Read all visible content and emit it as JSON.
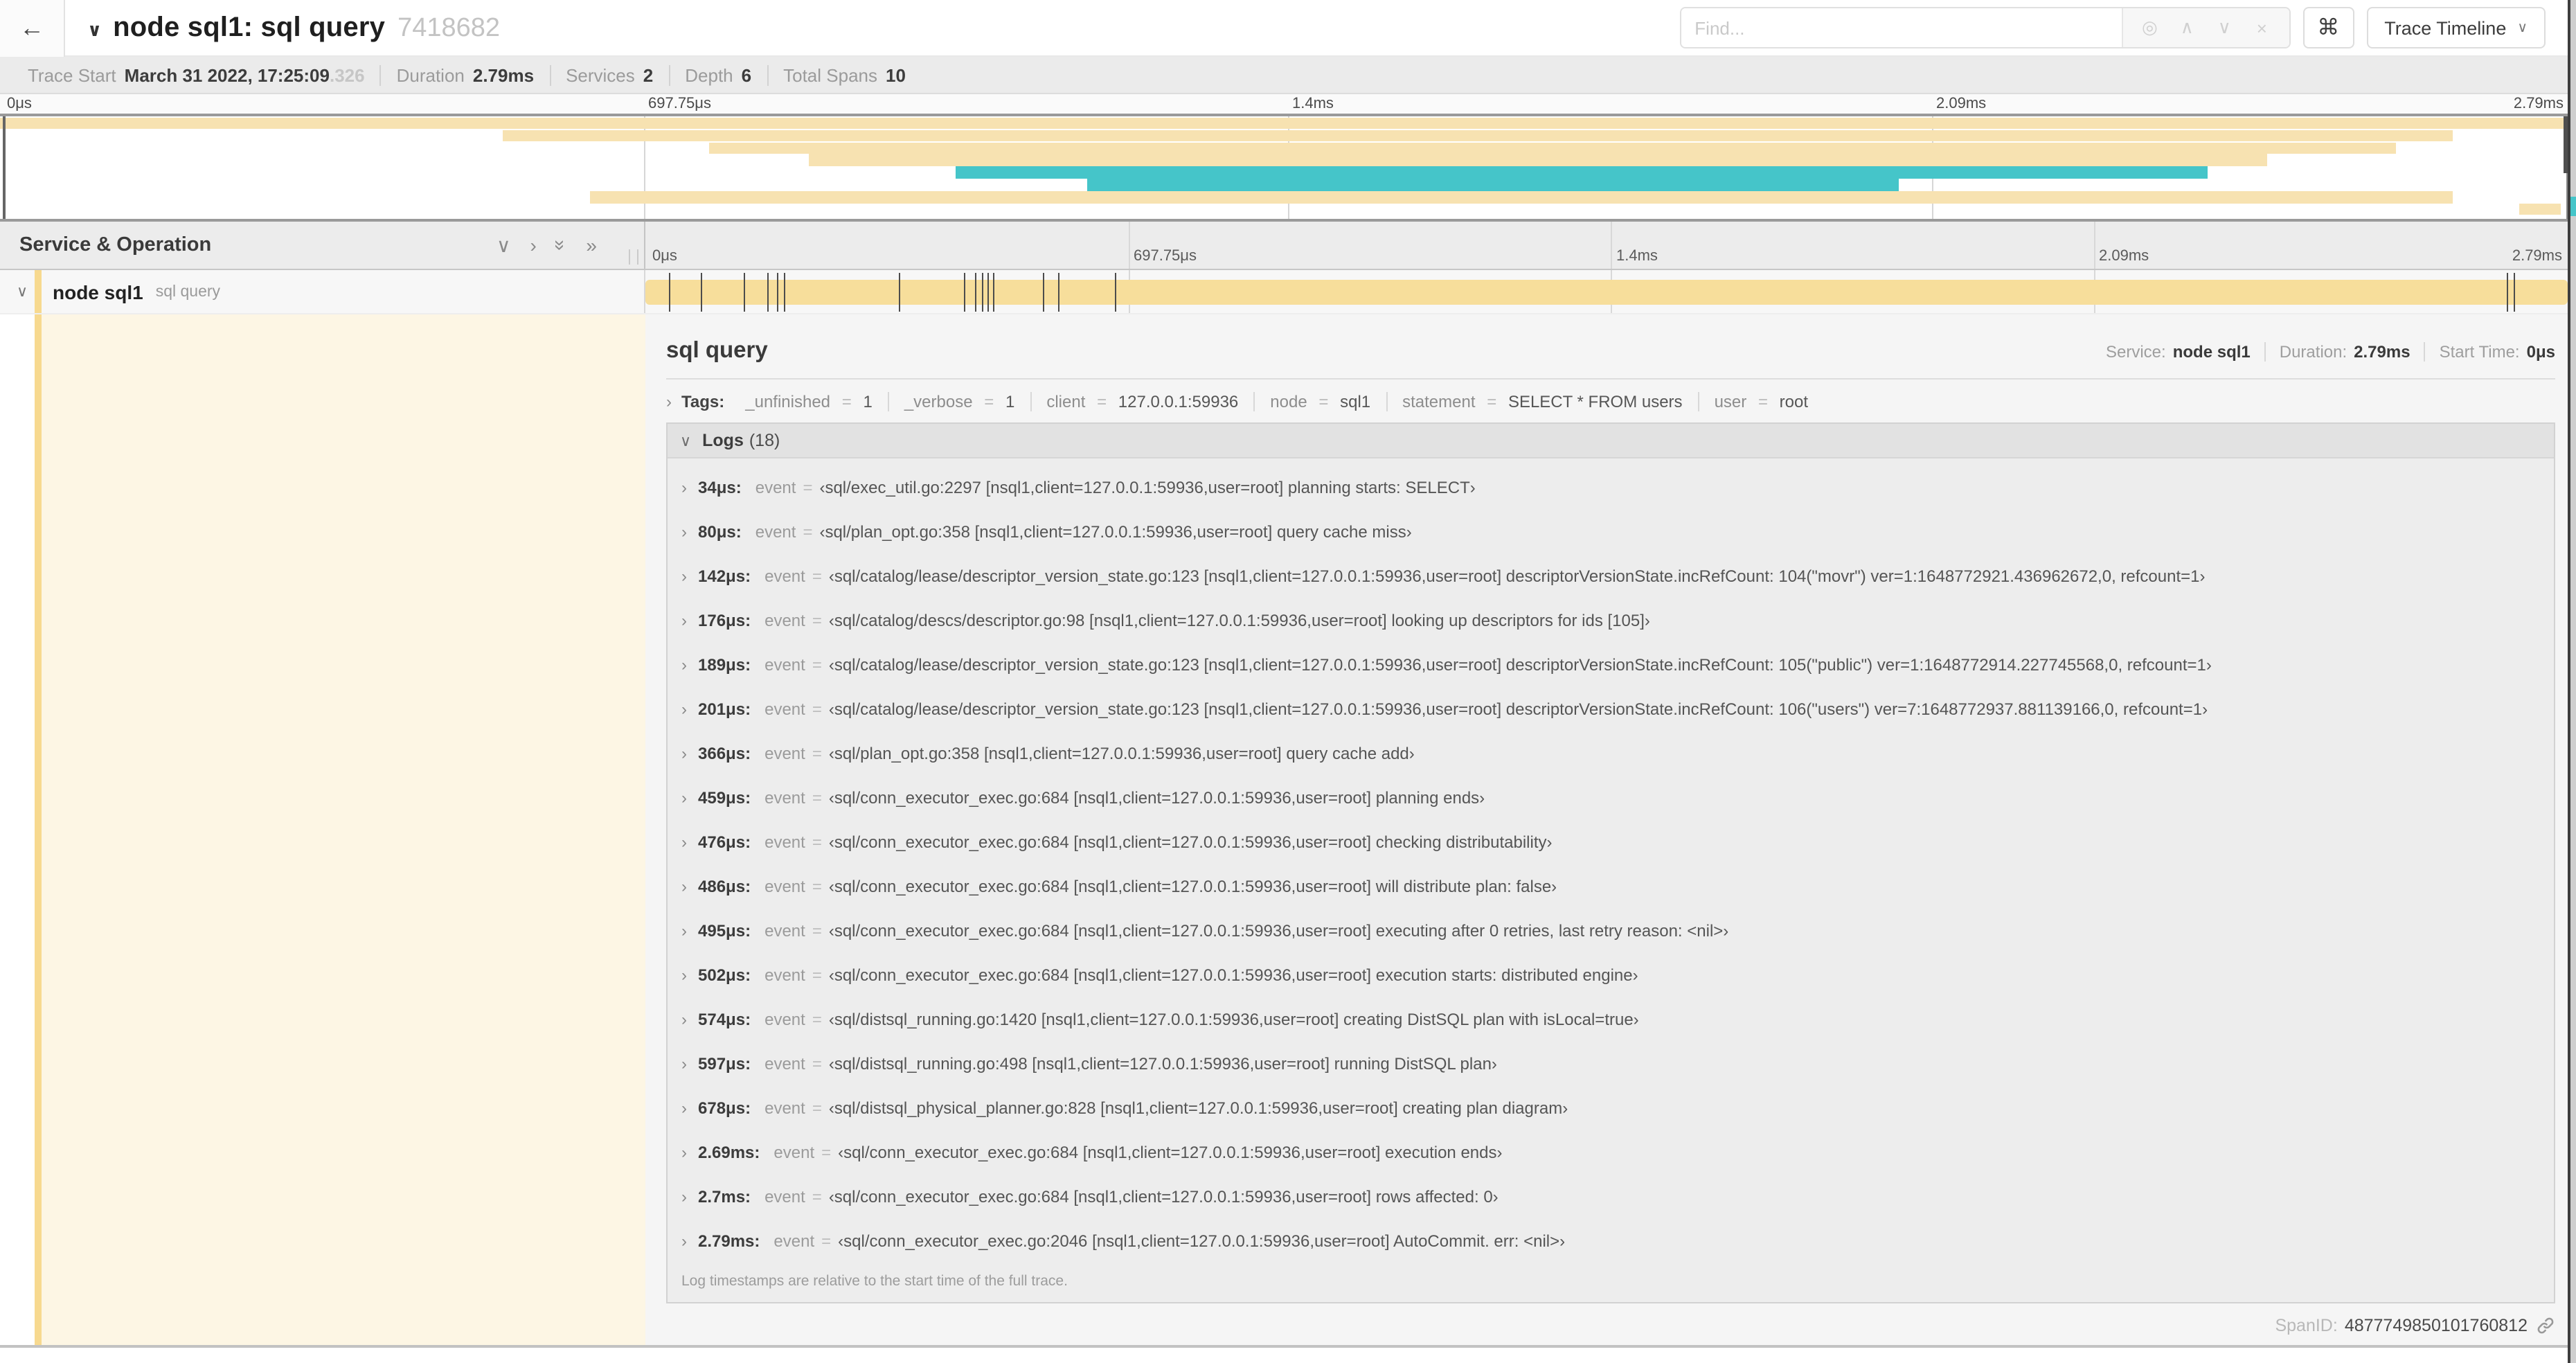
{
  "icons": {
    "back_arrow": "←",
    "chevron_down": "∨",
    "chevron_up": "∧",
    "chevron_right": "›",
    "double_chevron_right": "»",
    "locate": "◎",
    "close": "×",
    "command": "⌘"
  },
  "eq": "=",
  "header": {
    "title": "node sql1: sql query",
    "trace_id": "7418682",
    "find_placeholder": "Find...",
    "view_selector": "Trace Timeline"
  },
  "trace_info": {
    "items": [
      {
        "label": "Trace Start",
        "value": "March 31 2022, 17:25:09",
        "suffix": ".326"
      },
      {
        "label": "Duration",
        "value": "2.79ms"
      },
      {
        "label": "Services",
        "value": "2"
      },
      {
        "label": "Depth",
        "value": "6"
      },
      {
        "label": "Total Spans",
        "value": "10"
      }
    ]
  },
  "colors": {
    "span_tan": "#F7DE9B",
    "span_tan_light": "#F7E2B1",
    "span_teal": "#45C5C9",
    "strip": "#F7D98F",
    "cream": "#FDF6E4"
  },
  "minimap": {
    "ticks": [
      "0μs",
      "697.75μs",
      "1.4ms",
      "2.09ms",
      "2.79ms"
    ],
    "rows": [
      {
        "top": "1%",
        "left": "0%",
        "width": "100%",
        "color": "#F7E2B1"
      },
      {
        "top": "13%",
        "left": "19.5%",
        "width": "75.7%",
        "color": "#F7E2B1"
      },
      {
        "top": "25%",
        "left": "27.5%",
        "width": "65.5%",
        "color": "#F7E2B1"
      },
      {
        "top": "37%",
        "left": "31.4%",
        "width": "56.6%",
        "color": "#F7E2B1"
      },
      {
        "top": "49%",
        "left": "37.1%",
        "width": "48.6%",
        "color": "#45C5C9"
      },
      {
        "top": "61%",
        "left": "42.2%",
        "width": "31.5%",
        "color": "#45C5C9"
      },
      {
        "top": "73%",
        "left": "22.9%",
        "width": "72.3%",
        "color": "#F7E2B1"
      },
      {
        "top": "85%",
        "left": "97.8%",
        "width": "1.6%",
        "color": "#F7E2B1"
      }
    ]
  },
  "timeline": {
    "left_header": "Service & Operation",
    "ticks": [
      "0μs",
      "697.75μs",
      "1.4ms",
      "2.09ms",
      "2.79ms"
    ],
    "span_row": {
      "service": "node sql1",
      "operation": "sql query",
      "log_marks": [
        "1.2%",
        "2.9%",
        "5.1%",
        "6.3%",
        "6.8%",
        "7.2%",
        "13.1%",
        "16.5%",
        "17.1%",
        "17.4%",
        "17.7%",
        "18%",
        "20.6%",
        "21.4%",
        "24.3%",
        "96.4%",
        "96.8%",
        "99.6%"
      ]
    }
  },
  "detail": {
    "title": "sql query",
    "meta": [
      {
        "label": "Service:",
        "value": "node sql1"
      },
      {
        "label": "Duration:",
        "value": "2.79ms"
      },
      {
        "label": "Start Time:",
        "value": "0μs"
      }
    ],
    "tags_label": "Tags:",
    "tags": [
      {
        "key": "_unfinished",
        "value": "1"
      },
      {
        "key": "_verbose",
        "value": "1"
      },
      {
        "key": "client",
        "value": "127.0.0.1:59936"
      },
      {
        "key": "node",
        "value": "sql1"
      },
      {
        "key": "statement",
        "value": "SELECT * FROM users"
      },
      {
        "key": "user",
        "value": "root"
      }
    ],
    "logs_label": "Logs",
    "logs_count": "(18)",
    "log_field": "event",
    "logs": [
      {
        "time": "34μs:",
        "value": "‹sql/exec_util.go:2297 [nsql1,client=127.0.0.1:59936,user=root] planning starts: SELECT›"
      },
      {
        "time": "80μs:",
        "value": "‹sql/plan_opt.go:358 [nsql1,client=127.0.0.1:59936,user=root] query cache miss›"
      },
      {
        "time": "142μs:",
        "value": "‹sql/catalog/lease/descriptor_version_state.go:123 [nsql1,client=127.0.0.1:59936,user=root] descriptorVersionState.incRefCount: 104(\"movr\") ver=1:1648772921.436962672,0, refcount=1›"
      },
      {
        "time": "176μs:",
        "value": "‹sql/catalog/descs/descriptor.go:98 [nsql1,client=127.0.0.1:59936,user=root] looking up descriptors for ids [105]›"
      },
      {
        "time": "189μs:",
        "value": "‹sql/catalog/lease/descriptor_version_state.go:123 [nsql1,client=127.0.0.1:59936,user=root] descriptorVersionState.incRefCount: 105(\"public\") ver=1:1648772914.227745568,0, refcount=1›"
      },
      {
        "time": "201μs:",
        "value": "‹sql/catalog/lease/descriptor_version_state.go:123 [nsql1,client=127.0.0.1:59936,user=root] descriptorVersionState.incRefCount: 106(\"users\") ver=7:1648772937.881139166,0, refcount=1›"
      },
      {
        "time": "366μs:",
        "value": "‹sql/plan_opt.go:358 [nsql1,client=127.0.0.1:59936,user=root] query cache add›"
      },
      {
        "time": "459μs:",
        "value": "‹sql/conn_executor_exec.go:684 [nsql1,client=127.0.0.1:59936,user=root] planning ends›"
      },
      {
        "time": "476μs:",
        "value": "‹sql/conn_executor_exec.go:684 [nsql1,client=127.0.0.1:59936,user=root] checking distributability›"
      },
      {
        "time": "486μs:",
        "value": "‹sql/conn_executor_exec.go:684 [nsql1,client=127.0.0.1:59936,user=root] will distribute plan: false›"
      },
      {
        "time": "495μs:",
        "value": "‹sql/conn_executor_exec.go:684 [nsql1,client=127.0.0.1:59936,user=root] executing after 0 retries, last retry reason: <nil>›"
      },
      {
        "time": "502μs:",
        "value": "‹sql/conn_executor_exec.go:684 [nsql1,client=127.0.0.1:59936,user=root] execution starts: distributed engine›"
      },
      {
        "time": "574μs:",
        "value": "‹sql/distsql_running.go:1420 [nsql1,client=127.0.0.1:59936,user=root] creating DistSQL plan with isLocal=true›"
      },
      {
        "time": "597μs:",
        "value": "‹sql/distsql_running.go:498 [nsql1,client=127.0.0.1:59936,user=root] running DistSQL plan›"
      },
      {
        "time": "678μs:",
        "value": "‹sql/distsql_physical_planner.go:828 [nsql1,client=127.0.0.1:59936,user=root] creating plan diagram›"
      },
      {
        "time": "2.69ms:",
        "value": "‹sql/conn_executor_exec.go:684 [nsql1,client=127.0.0.1:59936,user=root] execution ends›"
      },
      {
        "time": "2.7ms:",
        "value": "‹sql/conn_executor_exec.go:684 [nsql1,client=127.0.0.1:59936,user=root] rows affected: 0›"
      },
      {
        "time": "2.79ms:",
        "value": "‹sql/conn_executor_exec.go:2046 [nsql1,client=127.0.0.1:59936,user=root] AutoCommit. err: <nil>›"
      }
    ],
    "note": "Log timestamps are relative to the start time of the full trace.",
    "span_id_label": "SpanID:",
    "span_id": "4877749850101760812"
  }
}
